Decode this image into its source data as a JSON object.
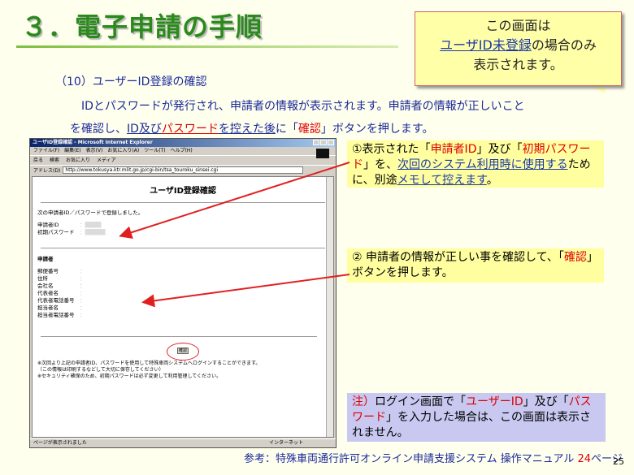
{
  "slide": {
    "title": "３．電子申請の手順",
    "section_head": "（10）ユーザーID登録の確認",
    "desc_line1": "IDとパスワードが発行され、申請者の情報が表示されます。申請者の情報が正しいこと",
    "desc_line2": {
      "p1": "を確認し、",
      "p2": "ID及び",
      "p3": "パスワード",
      "p4": "を控えた後",
      "p5": "に「",
      "p6": "確認",
      "p7": "」ボタンを押します。"
    },
    "page_number": "25"
  },
  "callout": {
    "line1": "この画面は",
    "line2a": "ユーザID未登録",
    "line2b": "の場合のみ",
    "line3": "表示されます。"
  },
  "browser": {
    "title": "ユーザID登録確認 - Microsoft Internet Explorer",
    "menu": [
      "ファイル(F)",
      "編集(E)",
      "表示(V)",
      "お気に入り(A)",
      "ツール(T)",
      "ヘルプ(H)"
    ],
    "toolbar": [
      "戻る",
      "検索",
      "お気に入り",
      "メディア"
    ],
    "address_label": "アドレス(D)",
    "address": "http://www.tokusya.ktr.mlit.go.jp/cgi-bin/tsa_touroku_sinsei.cgi",
    "page": {
      "heading": "ユーザID登録確認",
      "intro": "次の申請者ID／パスワードで登録しました。",
      "id_label": "申請者ID",
      "pw_label": "初期パスワード",
      "section": "申請者",
      "fields": [
        {
          "label": "郵便番号",
          "value": "："
        },
        {
          "label": "住所",
          "value": "："
        },
        {
          "label": "会社名",
          "value": "："
        },
        {
          "label": "代表者名",
          "value": "："
        },
        {
          "label": "代表者電話番号",
          "value": "："
        },
        {
          "label": "担当者名",
          "value": "："
        },
        {
          "label": "担当者電話番号",
          "value": "："
        }
      ],
      "button": "確認",
      "note1": "※次回より上記の申請者ID、パスワードを使用して特殊車両システムへログインすることができます。",
      "note2": "（この情報は印刷するなどして大切に保存してください）",
      "note3": "※セキュリティ確保のため、初期パスワードは必ず変更して利用管理してください。"
    },
    "status_left": "ページが表示されました",
    "status_right": "インターネット"
  },
  "annotations": {
    "a1": {
      "p1": "①表示された「",
      "p2": "申請者ID",
      "p3": "」及び「",
      "p4": "初期パスワード",
      "p5": "」を、",
      "p6": "次回のシステム利用時に使用する",
      "p7": "ために、別途",
      "p8": "メモして控えます",
      "p9": "。"
    },
    "a2": {
      "p1": "② 申請者の情報が正しい事を確認して、「",
      "p2": "確認",
      "p3": "」ボタンを押します。"
    },
    "a3": {
      "p1": "注）",
      "p2": "ログイン画面で「",
      "p3": "ユーザーID",
      "p4": "」及び「",
      "p5": "パスワード",
      "p6": "」を入力した場合は、この画面は表示されません。"
    }
  },
  "footer": {
    "p1": "参考：特殊車両通行許可オンライン申請支援システム 操作マニュアル ",
    "p2": "24",
    "p3": "ページ"
  }
}
